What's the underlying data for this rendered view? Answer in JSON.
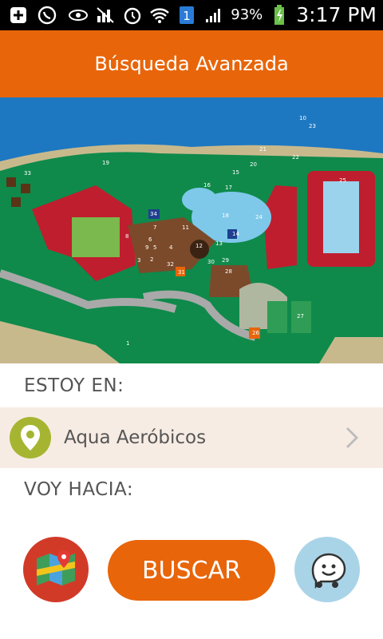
{
  "status_bar": {
    "battery_pct": "93%",
    "time": "3:17 PM",
    "sim_slot": "1",
    "icons": [
      "plus-icon",
      "whatsapp-icon",
      "eye-icon",
      "signal-muted-icon",
      "alarm-icon",
      "wifi-icon",
      "sim-icon",
      "cell-signal-icon",
      "battery-charging-icon"
    ]
  },
  "app_bar": {
    "title": "Búsqueda Avanzada",
    "background": "#e8650a"
  },
  "map": {
    "markers": [
      "1",
      "2",
      "3",
      "5",
      "6",
      "7",
      "8",
      "9",
      "10",
      "11",
      "12",
      "13",
      "14",
      "15",
      "16",
      "17",
      "18",
      "19",
      "20",
      "21",
      "22",
      "23",
      "24",
      "25",
      "26",
      "27",
      "28",
      "29",
      "30",
      "31",
      "32",
      "33",
      "34"
    ]
  },
  "form": {
    "current_label": "ESTOY EN:",
    "current_value": "Aqua Aeróbicos",
    "destination_label": "VOY HACIA:"
  },
  "actions": {
    "search_label": "BUSCAR",
    "maps_icon": "google-maps-icon",
    "waze_icon": "waze-icon"
  }
}
